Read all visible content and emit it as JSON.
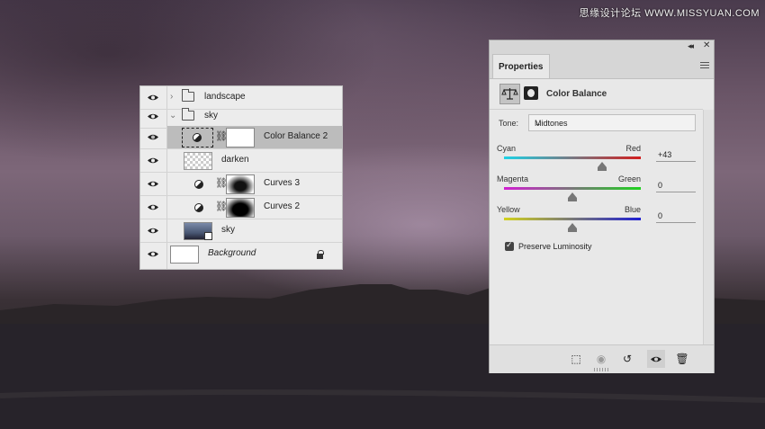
{
  "watermark": "思缘设计论坛 WWW.MISSYUAN.COM",
  "layers_panel": {
    "rows": [
      {
        "name": "landscape",
        "italic": false
      },
      {
        "name": "sky",
        "italic": false
      },
      {
        "name": "Color Balance 2",
        "italic": false,
        "selected": true
      },
      {
        "name": "darken",
        "italic": false
      },
      {
        "name": "Curves 3",
        "italic": false
      },
      {
        "name": "Curves 2",
        "italic": false
      },
      {
        "name": "sky",
        "italic": false
      },
      {
        "name": "Background",
        "italic": true
      }
    ]
  },
  "properties_panel": {
    "tab_label": "Properties",
    "adjustment_title": "Color Balance",
    "tone": {
      "label": "Tone:",
      "value": "Midtones"
    },
    "sliders": [
      {
        "left": "Cyan",
        "right": "Red",
        "value": "+43",
        "level": 43,
        "colors": [
          "#1ed2e6",
          "#d21e1e"
        ]
      },
      {
        "left": "Magenta",
        "right": "Green",
        "value": "0",
        "level": 0,
        "colors": [
          "#d21ed2",
          "#1ed21e"
        ]
      },
      {
        "left": "Yellow",
        "right": "Blue",
        "value": "0",
        "level": 0,
        "colors": [
          "#d2d21e",
          "#1e1ed2"
        ]
      }
    ],
    "preserve_luminosity": {
      "label": "Preserve Luminosity",
      "checked": true
    }
  },
  "icons": [
    "eye-icon",
    "folder-icon",
    "chevron-right-icon",
    "chevron-down-icon",
    "adjustment-icon",
    "link-icon",
    "lock-icon",
    "clip-to-layer-icon",
    "view-previous-icon",
    "reset-icon",
    "visibility-icon",
    "trash-icon",
    "panel-menu-icon",
    "collapse-icon",
    "close-icon",
    "color-balance-icon",
    "mask-icon"
  ]
}
